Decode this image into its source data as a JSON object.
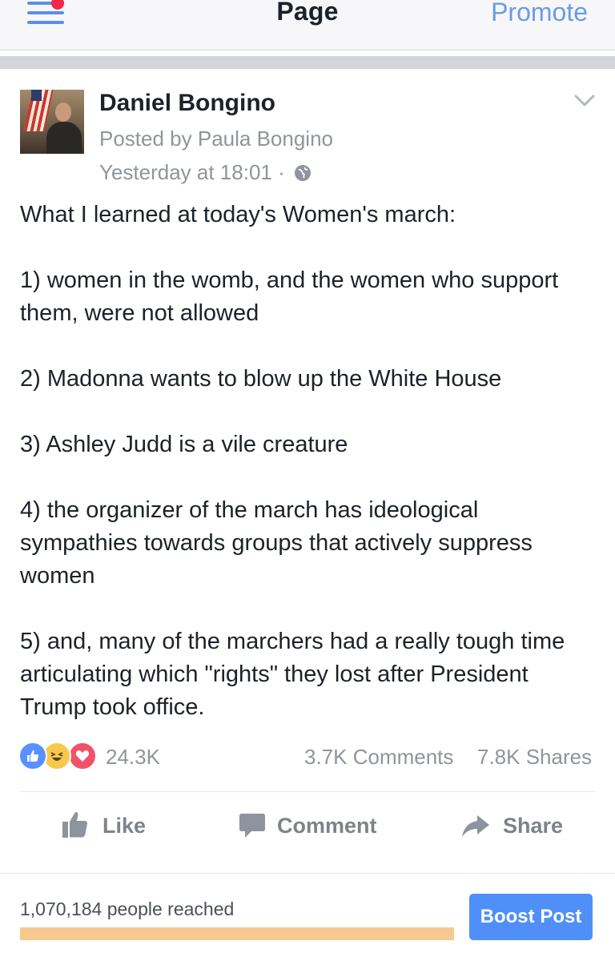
{
  "nav": {
    "title": "Page",
    "promote_label": "Promote",
    "menu_icon": "hamburger-icon",
    "notification_color": "#f02849",
    "accent_color": "#5c8ee8"
  },
  "post": {
    "author": "Daniel Bongino",
    "posted_by": "Posted by Paula Bongino",
    "timestamp": "Yesterday at 18:01 ·",
    "privacy_icon": "globe-icon",
    "options_icon": "chevron-down-icon",
    "paragraphs": [
      "What I learned at today's Women's march:",
      "1) women in the womb, and the women who support them, were not allowed",
      "2) Madonna wants to blow up the White House",
      "3) Ashley Judd is a vile creature",
      "4) the organizer of the march has ideological sympathies towards groups that actively suppress women",
      "5) and, many of the marchers had a really tough time articulating which \"rights\" they lost after President Trump took office."
    ]
  },
  "stats": {
    "reactions_icons": [
      "like-icon",
      "haha-icon",
      "love-icon"
    ],
    "reactions_count": "24.3K",
    "comments": "3.7K Comments",
    "shares": "7.8K Shares"
  },
  "actions": {
    "like": "Like",
    "comment": "Comment",
    "share": "Share"
  },
  "reach": {
    "text": "1,070,184 people reached",
    "fill_fraction": 1.0,
    "boost_label": "Boost Post",
    "boost_color": "#4f8ff7"
  }
}
